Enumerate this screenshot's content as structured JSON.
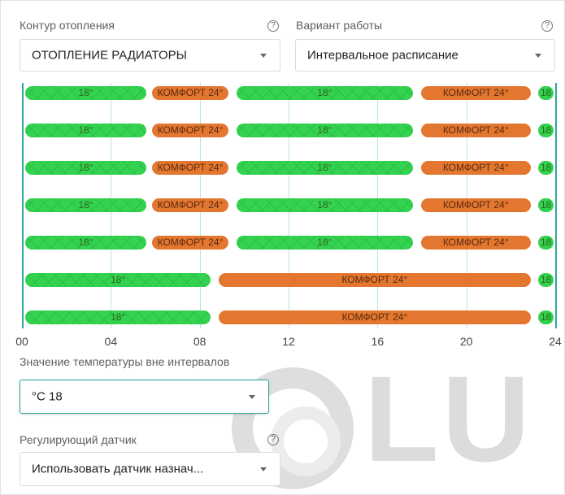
{
  "circuit": {
    "label": "Контур отопления",
    "help_glyph": "?",
    "value": "ОТОПЛЕНИЕ РАДИАТОРЫ"
  },
  "mode": {
    "label": "Вариант работы",
    "help_glyph": "?",
    "value": "Интервальное расписание"
  },
  "schedule": {
    "hours_range": [
      0,
      24
    ],
    "tick_labels": [
      "00",
      "04",
      "08",
      "12",
      "16",
      "20",
      "24"
    ],
    "colors": {
      "eco": "#33d24f",
      "comfort": "#e3772f",
      "axis": "#2ea69a"
    },
    "rows": [
      {
        "segments": [
          {
            "start": 0,
            "end": 5.6,
            "label": "18°",
            "kind": "eco"
          },
          {
            "start": 5.7,
            "end": 9.3,
            "label": "КОМФОРТ 24°",
            "kind": "comfort"
          },
          {
            "start": 9.5,
            "end": 17.6,
            "label": "18°",
            "kind": "eco"
          },
          {
            "start": 17.8,
            "end": 22.9,
            "label": "КОМФОРТ 24°",
            "kind": "comfort"
          },
          {
            "start": 23.1,
            "end": 24,
            "label": "18",
            "kind": "eco"
          }
        ]
      },
      {
        "segments": [
          {
            "start": 0,
            "end": 5.6,
            "label": "18°",
            "kind": "eco"
          },
          {
            "start": 5.7,
            "end": 9.3,
            "label": "КОМФОРТ 24°",
            "kind": "comfort"
          },
          {
            "start": 9.5,
            "end": 17.6,
            "label": "18°",
            "kind": "eco"
          },
          {
            "start": 17.8,
            "end": 22.9,
            "label": "КОМФОРТ 24°",
            "kind": "comfort"
          },
          {
            "start": 23.1,
            "end": 24,
            "label": "18",
            "kind": "eco"
          }
        ]
      },
      {
        "segments": [
          {
            "start": 0,
            "end": 5.6,
            "label": "18°",
            "kind": "eco"
          },
          {
            "start": 5.7,
            "end": 9.3,
            "label": "КОМФОРТ 24°",
            "kind": "comfort"
          },
          {
            "start": 9.5,
            "end": 17.6,
            "label": "18°",
            "kind": "eco"
          },
          {
            "start": 17.8,
            "end": 22.9,
            "label": "КОМФОРТ 24°",
            "kind": "comfort"
          },
          {
            "start": 23.1,
            "end": 24,
            "label": "18",
            "kind": "eco"
          }
        ]
      },
      {
        "segments": [
          {
            "start": 0,
            "end": 5.6,
            "label": "18°",
            "kind": "eco"
          },
          {
            "start": 5.7,
            "end": 9.3,
            "label": "КОМФОРТ 24°",
            "kind": "comfort"
          },
          {
            "start": 9.5,
            "end": 17.6,
            "label": "18°",
            "kind": "eco"
          },
          {
            "start": 17.8,
            "end": 22.9,
            "label": "КОМФОРТ 24°",
            "kind": "comfort"
          },
          {
            "start": 23.1,
            "end": 24,
            "label": "18",
            "kind": "eco"
          }
        ]
      },
      {
        "segments": [
          {
            "start": 0,
            "end": 5.6,
            "label": "18°",
            "kind": "eco"
          },
          {
            "start": 5.7,
            "end": 9.3,
            "label": "КОМФОРТ 24°",
            "kind": "comfort"
          },
          {
            "start": 9.5,
            "end": 17.6,
            "label": "18°",
            "kind": "eco"
          },
          {
            "start": 17.8,
            "end": 22.9,
            "label": "КОМФОРТ 24°",
            "kind": "comfort"
          },
          {
            "start": 23.1,
            "end": 24,
            "label": "18",
            "kind": "eco"
          }
        ]
      },
      {
        "segments": [
          {
            "start": 0,
            "end": 8.5,
            "label": "18°",
            "kind": "eco"
          },
          {
            "start": 8.7,
            "end": 22.9,
            "label": "КОМФОРТ 24°",
            "kind": "comfort"
          },
          {
            "start": 23.1,
            "end": 24,
            "label": "18",
            "kind": "eco"
          }
        ]
      },
      {
        "segments": [
          {
            "start": 0,
            "end": 8.5,
            "label": "18°",
            "kind": "eco"
          },
          {
            "start": 8.7,
            "end": 22.9,
            "label": "КОМФОРТ 24°",
            "kind": "comfort"
          },
          {
            "start": 23.1,
            "end": 24,
            "label": "18",
            "kind": "eco"
          }
        ]
      }
    ]
  },
  "outside_temp": {
    "label": "Значение температуры вне интервалов",
    "value": "°C  18"
  },
  "sensor": {
    "label": "Регулирующий датчик",
    "help_glyph": "?",
    "value": "Использовать датчик назнач..."
  },
  "watermark": {
    "text": "LU"
  }
}
